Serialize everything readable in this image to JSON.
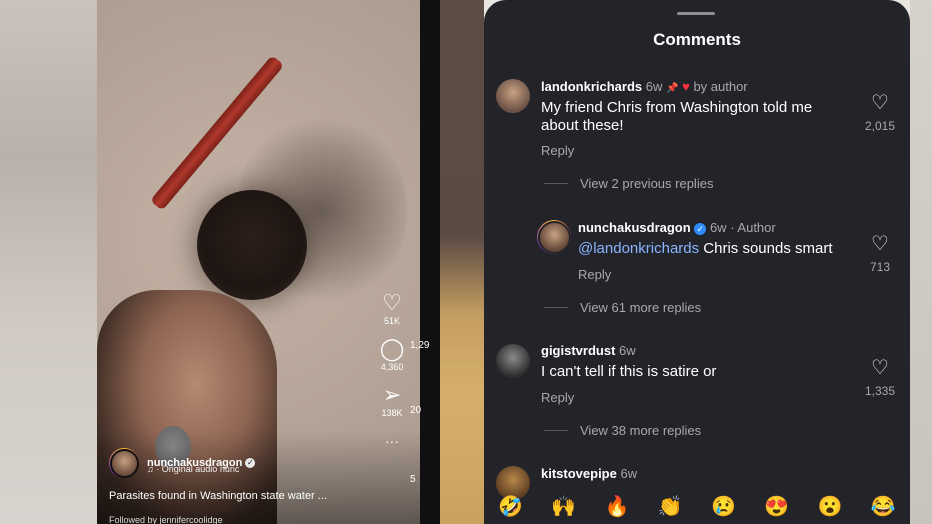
{
  "video": {
    "creator": "nunchakusdragon",
    "audio_prefix": "♫",
    "audio": "Original audio",
    "audio_user": "nunc",
    "caption": "Parasites found in Washington state water ...",
    "followed_by": "Followed by jennifercoolidge",
    "actions": [
      {
        "icon": "heart-icon",
        "glyph": "♡",
        "count": "51K"
      },
      {
        "icon": "comment-icon",
        "glyph": "◯",
        "count": "4,360"
      },
      {
        "icon": "share-icon",
        "glyph": "➢",
        "count": "138K"
      },
      {
        "icon": "more-icon",
        "glyph": "···",
        "count": ""
      }
    ],
    "next_counts": [
      "1,29",
      "20",
      "5"
    ]
  },
  "comments": {
    "title": "Comments",
    "items": [
      {
        "user": "landonkrichards",
        "time": "6w",
        "pinned": "📌",
        "liked_by_author_heart": "♥",
        "liked_by_author_label": "by author",
        "text": "My friend Chris from Washington told me about these!",
        "reply_label": "Reply",
        "likes": "2,015",
        "view_replies": "View 2 previous replies"
      },
      {
        "user": "nunchakusdragon",
        "verified": "✓",
        "time": "6w",
        "author_label": "Author",
        "mention": "@landonkrichards",
        "text": " Chris sounds smart",
        "reply_label": "Reply",
        "likes": "713",
        "view_replies": "View 61 more replies"
      },
      {
        "user": "gigistvrdust",
        "time": "6w",
        "text": "I can't tell if this is satire or",
        "reply_label": "Reply",
        "likes": "1,335",
        "view_replies": "View 38 more replies"
      },
      {
        "user": "kitstovepipe",
        "time": "6w"
      }
    ],
    "emojis": [
      "🤣",
      "🙌",
      "🔥",
      "👏",
      "😢",
      "😍",
      "😮",
      "😂"
    ]
  }
}
